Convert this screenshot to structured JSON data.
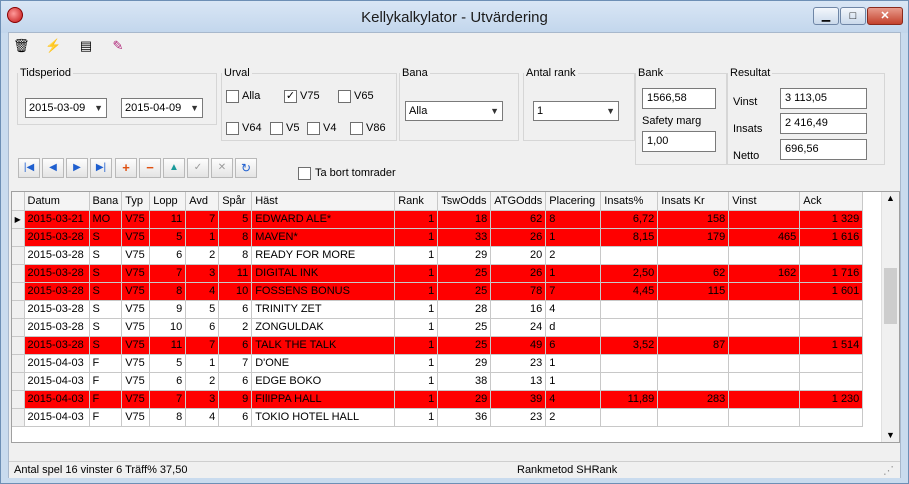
{
  "window": {
    "title": "Kellykalkylator - Utvärdering",
    "minimize_label": "▁",
    "maximize_label": "□",
    "close_label": "✕"
  },
  "toolbar": {
    "icons": [
      "trash-icon",
      "lightning-icon",
      "calculator-icon",
      "eraser-icon"
    ]
  },
  "tidsperiod": {
    "legend": "Tidsperiod",
    "from": "2015-03-09",
    "to": "2015-04-09"
  },
  "urval": {
    "legend": "Urval",
    "options": [
      {
        "label": "Alla",
        "checked": false
      },
      {
        "label": "V75",
        "checked": true
      },
      {
        "label": "V65",
        "checked": false
      },
      {
        "label": "V64",
        "checked": false
      },
      {
        "label": "V5",
        "checked": false
      },
      {
        "label": "V4",
        "checked": false
      },
      {
        "label": "V86",
        "checked": false
      }
    ]
  },
  "bana": {
    "legend": "Bana",
    "value": "Alla"
  },
  "antal_rank": {
    "legend": "Antal rank",
    "value": "1"
  },
  "bank": {
    "legend": "Bank",
    "value": "1566,58",
    "safety_label": "Safety marg",
    "safety_value": "1,00"
  },
  "resultat": {
    "legend": "Resultat",
    "vinst_label": "Vinst",
    "vinst_value": "3 113,05",
    "insats_label": "Insats",
    "insats_value": "2 416,49",
    "netto_label": "Netto",
    "netto_value": "696,56"
  },
  "navigator": {
    "buttons": [
      "first-icon",
      "prior-icon",
      "next-icon",
      "last-icon",
      "insert-icon",
      "delete-icon",
      "edit-icon",
      "post-icon",
      "cancel-icon",
      "refresh-icon"
    ],
    "remove_empty_label": "Ta bort tomrader",
    "remove_empty_checked": false
  },
  "grid": {
    "columns": [
      "Datum",
      "Bana",
      "Typ",
      "Lopp",
      "Avd",
      "Spår",
      "Häst",
      "Rank",
      "TswOdds",
      "ATGOdds",
      "Placering",
      "Insats%",
      "Insats Kr",
      "Vinst",
      "Ack"
    ],
    "rows": [
      {
        "win": true,
        "current": true,
        "cells": [
          "2015-03-21",
          "MO",
          "V75",
          "11",
          "7",
          "5",
          "EDWARD ALE*",
          "1",
          "18",
          "62",
          "8",
          "6,72",
          "158",
          "",
          "1 329"
        ]
      },
      {
        "win": true,
        "current": false,
        "cells": [
          "2015-03-28",
          "S",
          "V75",
          "5",
          "1",
          "8",
          "MAVEN*",
          "1",
          "33",
          "26",
          "1",
          "8,15",
          "179",
          "465",
          "1 616"
        ]
      },
      {
        "win": false,
        "current": false,
        "cells": [
          "2015-03-28",
          "S",
          "V75",
          "6",
          "2",
          "8",
          "READY FOR MORE",
          "1",
          "29",
          "20",
          "2",
          "",
          "",
          "",
          ""
        ]
      },
      {
        "win": true,
        "current": false,
        "cells": [
          "2015-03-28",
          "S",
          "V75",
          "7",
          "3",
          "11",
          "DIGITAL INK",
          "1",
          "25",
          "26",
          "1",
          "2,50",
          "62",
          "162",
          "1 716"
        ]
      },
      {
        "win": true,
        "current": false,
        "cells": [
          "2015-03-28",
          "S",
          "V75",
          "8",
          "4",
          "10",
          "FOSSENS BONUS",
          "1",
          "25",
          "78",
          "7",
          "4,45",
          "115",
          "",
          "1 601"
        ]
      },
      {
        "win": false,
        "current": false,
        "cells": [
          "2015-03-28",
          "S",
          "V75",
          "9",
          "5",
          "6",
          "TRINITY ZET",
          "1",
          "28",
          "16",
          "4",
          "",
          "",
          "",
          ""
        ]
      },
      {
        "win": false,
        "current": false,
        "cells": [
          "2015-03-28",
          "S",
          "V75",
          "10",
          "6",
          "2",
          "ZONGULDAK",
          "1",
          "25",
          "24",
          "d",
          "",
          "",
          "",
          ""
        ]
      },
      {
        "win": true,
        "current": false,
        "cells": [
          "2015-03-28",
          "S",
          "V75",
          "11",
          "7",
          "6",
          "TALK THE TALK",
          "1",
          "25",
          "49",
          "6",
          "3,52",
          "87",
          "",
          "1 514"
        ]
      },
      {
        "win": false,
        "current": false,
        "cells": [
          "2015-04-03",
          "F",
          "V75",
          "5",
          "1",
          "7",
          "D'ONE",
          "1",
          "29",
          "23",
          "1",
          "",
          "",
          "",
          ""
        ]
      },
      {
        "win": false,
        "current": false,
        "cells": [
          "2015-04-03",
          "F",
          "V75",
          "6",
          "2",
          "6",
          "EDGE BOKO",
          "1",
          "38",
          "13",
          "1",
          "",
          "",
          "",
          ""
        ]
      },
      {
        "win": true,
        "current": false,
        "cells": [
          "2015-04-03",
          "F",
          "V75",
          "7",
          "3",
          "9",
          "FIlIPPA HALL",
          "1",
          "29",
          "39",
          "4",
          "11,89",
          "283",
          "",
          "1 230"
        ]
      },
      {
        "win": false,
        "current": false,
        "cells": [
          "2015-04-03",
          "F",
          "V75",
          "8",
          "4",
          "6",
          "TOKIO HOTEL HALL",
          "1",
          "36",
          "23",
          "2",
          "",
          "",
          "",
          ""
        ]
      }
    ]
  },
  "status": {
    "summary": "Antal spel 16  vinster 6   Träff%  37,50",
    "rankmetod": "Rankmetod SHRank"
  },
  "colors": {
    "win_row": "#ff0000",
    "title_bg": "#c9dbee"
  }
}
